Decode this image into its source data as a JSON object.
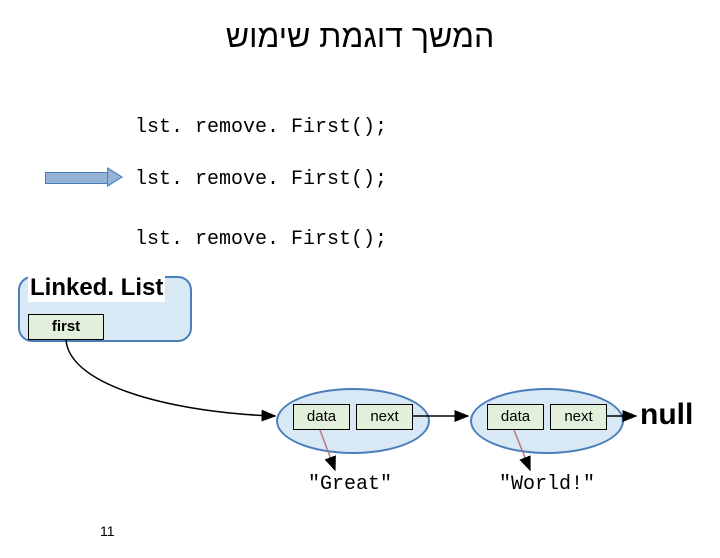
{
  "title": "המשך דוגמת שימוש",
  "code": {
    "line1": "lst. remove. First();",
    "line2": "lst. remove. First();",
    "line3": "lst. remove. First();"
  },
  "linkedlist": {
    "label": "Linked. List",
    "first_field": "first"
  },
  "node1": {
    "data_field": "data",
    "next_field": "next",
    "data_value": "\"Great\""
  },
  "node2": {
    "data_field": "data",
    "next_field": "next",
    "data_value": "\"World!\""
  },
  "null_label": "null",
  "page_number": "11"
}
